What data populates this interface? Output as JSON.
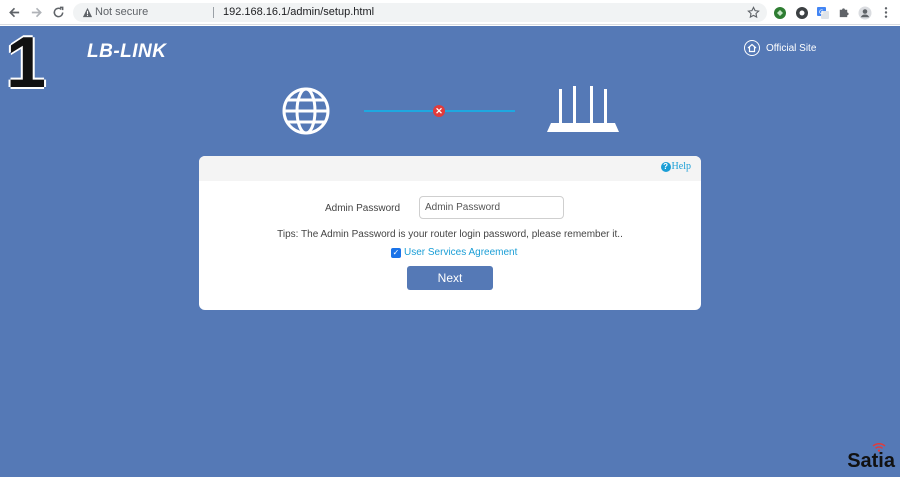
{
  "browser": {
    "back_icon": "arrow-left-icon",
    "forward_icon": "arrow-right-icon",
    "reload_icon": "reload-icon",
    "security_label": "Not secure",
    "url": "192.168.16.1/admin/setup.html"
  },
  "page": {
    "step_number": "1",
    "logo_text": "LB-LINK",
    "official_site_label": "Official Site",
    "watermark": "Satia"
  },
  "form": {
    "help_label": "Help",
    "password_label": "Admin Password",
    "password_placeholder": "Admin Password",
    "tips": "Tips: The Admin Password is your router login password, please remember it..",
    "agreement_label": "User Services Agreement",
    "agreement_checked": true,
    "next_label": "Next"
  },
  "colors": {
    "background": "#5579b6",
    "accent": "#1a9ed6",
    "error": "#e23b3b"
  }
}
